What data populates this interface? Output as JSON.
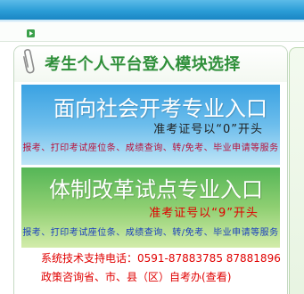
{
  "nav": {
    "icon": "green-arrow-icon"
  },
  "panel": {
    "title": "考生个人平台登入模块选择",
    "icon": "paperclip-icon"
  },
  "entries": [
    {
      "title": "面向社会开考专业入口",
      "note": "准考证号以“0”开头",
      "services": "报考、打印考试座位条、成绩查询、转/免考、毕业申请等服务"
    },
    {
      "title": "体制改革试点专业入口",
      "note": "准考证号以“9”开头",
      "services": "报考、打印考试座位条、成绩查询、转/免考、毕业申请等服务"
    }
  ],
  "footer": {
    "support": "系统技术支持电话：0591-87883785 87881896",
    "policy": "政策咨询省、市、县（区）自考办",
    "policy_link": "(查看)"
  },
  "colors": {
    "header": "#2b9dd7",
    "panel_title": "#2f8f3a",
    "entry_social_top": "#3aa2e2",
    "entry_social_bottom": "#bfe5f7",
    "entry_reform_top": "#55b657",
    "entry_reform_bottom": "#d3ecaa",
    "entry_title": "#ffffff",
    "note_social": "#1f1f1f",
    "note_reform": "#e00000",
    "services_social": "#b8103a",
    "services_reform": "#1b3fbf",
    "footer_text": "#e00000",
    "side_panel": "#e8f4e2"
  }
}
